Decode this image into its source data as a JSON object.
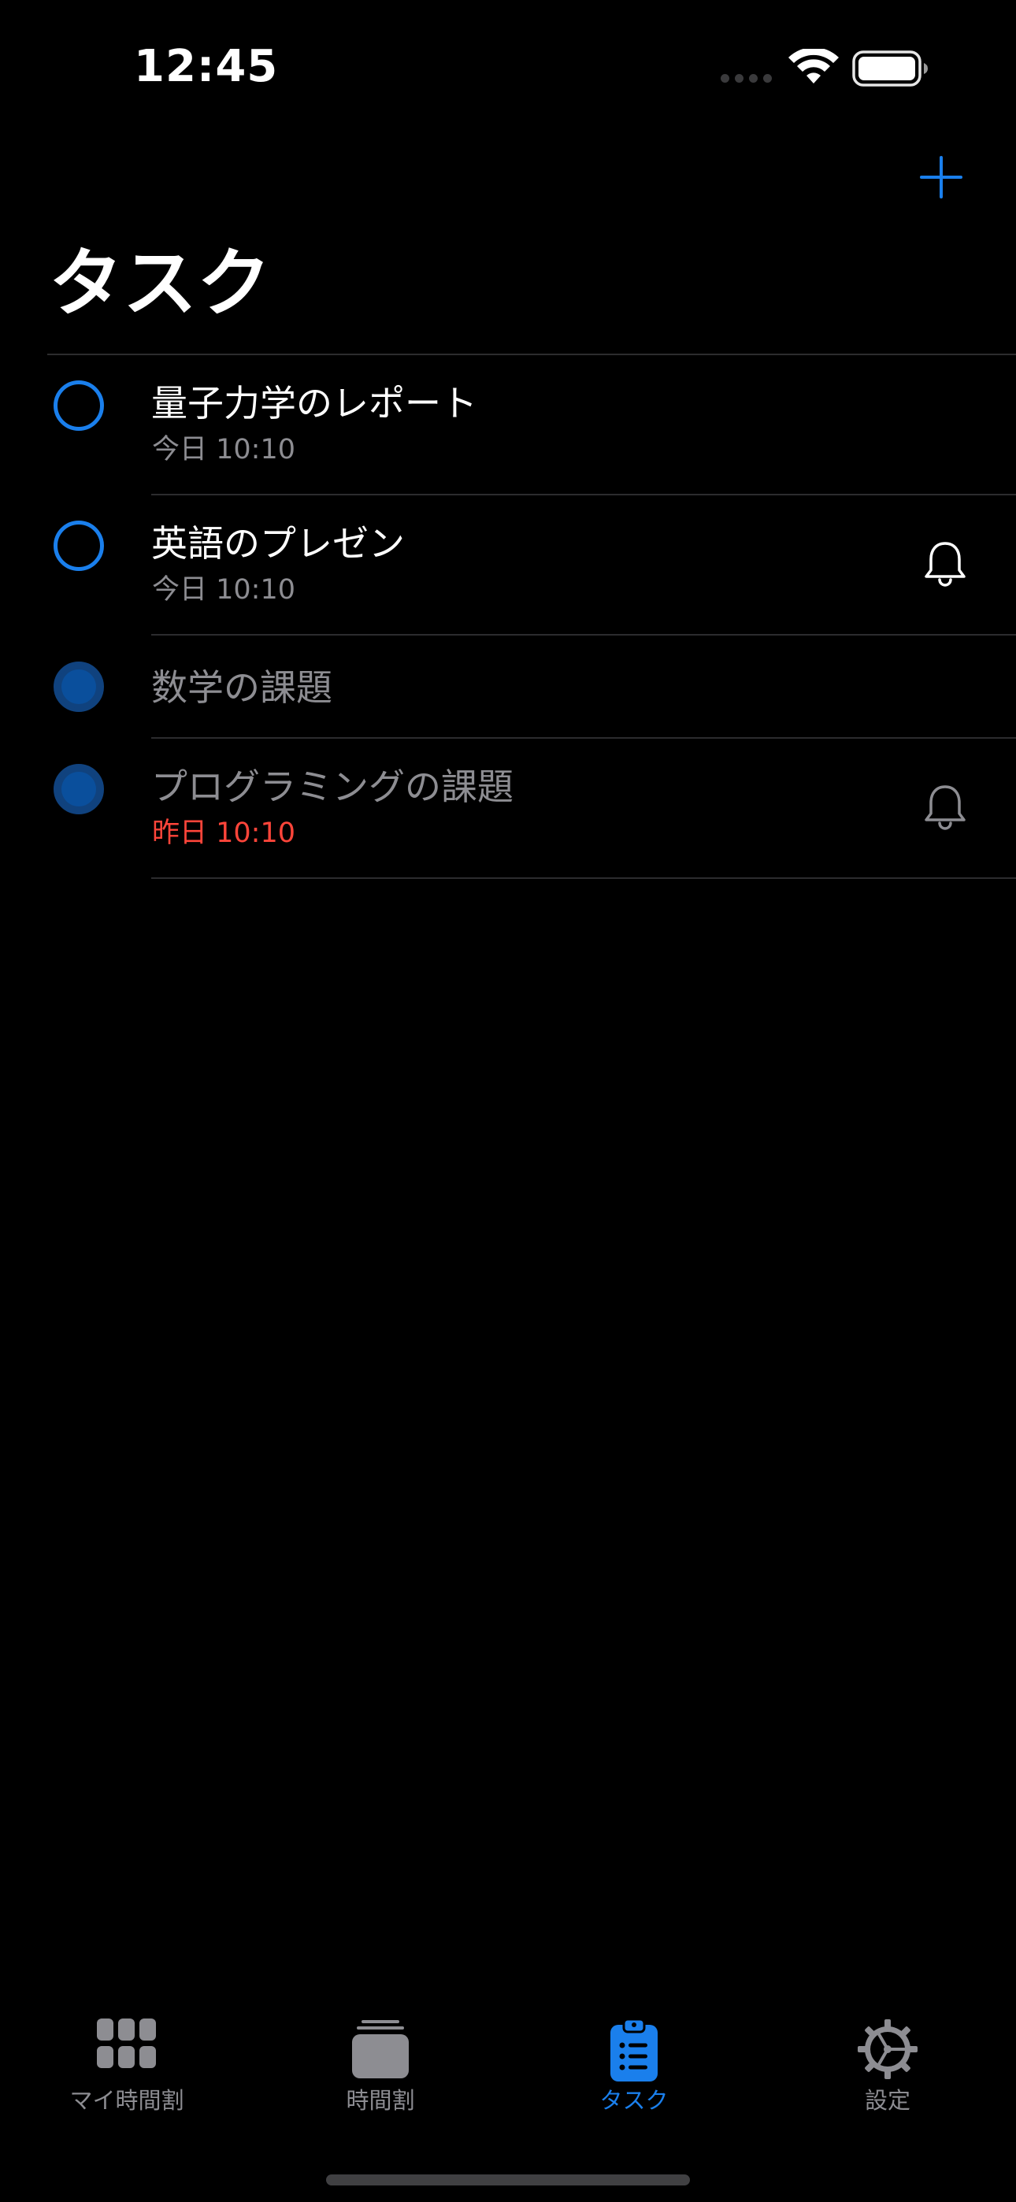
{
  "status_bar": {
    "time": "12:45"
  },
  "header": {
    "title": "タスク",
    "add_icon": "plus-icon",
    "accent_color": "#1a7fec"
  },
  "tasks": [
    {
      "title": "量子力学のレポート",
      "due": "今日 10:10",
      "completed": false,
      "reminder": false
    },
    {
      "title": "英語のプレゼン",
      "due": "今日 10:10",
      "completed": false,
      "reminder": true
    },
    {
      "title": "数学の課題",
      "due": "",
      "completed": true,
      "reminder": false
    },
    {
      "title": "プログラミングの課題",
      "due": "昨日 10:10",
      "completed": true,
      "reminder": true,
      "overdue": true
    }
  ],
  "tab_bar": {
    "tabs": [
      {
        "label": "マイ時間割",
        "icon": "grid-icon",
        "active": false
      },
      {
        "label": "時間割",
        "icon": "stack-icon",
        "active": false
      },
      {
        "label": "タスク",
        "icon": "clipboard-list-icon",
        "active": true
      },
      {
        "label": "設定",
        "icon": "gear-icon",
        "active": false
      }
    ]
  },
  "colors": {
    "overdue": "#ff453a",
    "muted": "#8d8d92",
    "completed_fill": "#0a4f9c"
  }
}
